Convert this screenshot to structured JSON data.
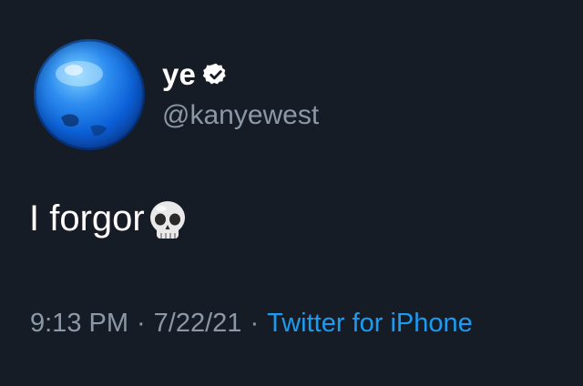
{
  "tweet": {
    "author": {
      "display_name": "ye",
      "handle": "@kanyewest",
      "verified": true,
      "avatar_icon": "blue-planet-avatar"
    },
    "text": "I forgor",
    "emoji": "skull",
    "time": "9:13 PM",
    "date": "7/22/21",
    "separator": "·",
    "source": "Twitter for iPhone"
  },
  "colors": {
    "background": "#161c26",
    "text_primary": "#ffffff",
    "text_secondary": "#8b98a5",
    "link": "#1d9bf0"
  }
}
